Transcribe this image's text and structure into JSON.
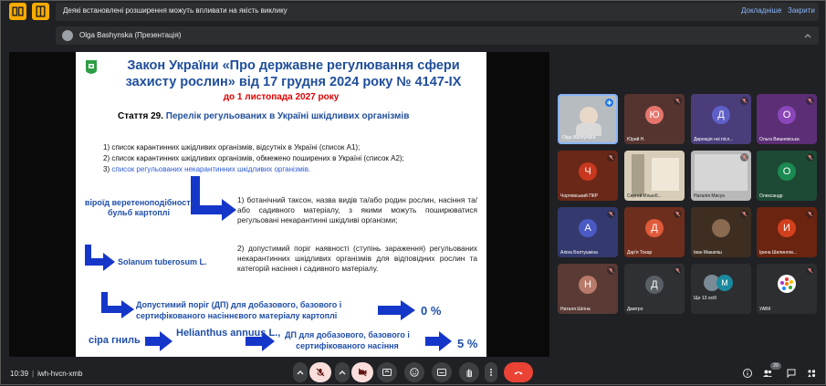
{
  "banner": {
    "message": "Деякі встановлені розширення можуть впливати на якість виклику",
    "details": "Докладніше",
    "close": "Закрити"
  },
  "presenter": {
    "label": "Olga Bashynska (Презентація)"
  },
  "slide": {
    "title": "Закон України «Про державне регулювання сфери захисту рослин» від 17 грудня 2024 року № 4147-ІХ",
    "date": "до 1 листопада 2027 року",
    "article_num": "Стаття 29.",
    "article_title": "Перелік регульованих в Україні шкідливих організмів",
    "list": [
      "1) список карантинних шкідливих організмів, відсутніх в Україні (список А1);",
      "2) список карантинних шкідливих організмів, обмежено поширених в Україні (список А2);",
      "3)",
      "список регульованих некарантинних шкідливих організмів."
    ],
    "viroid": "віроїд веретеноподібності бульб картоплі",
    "solanum": "Solanum tuberosum L.",
    "para1": "1) ботанічний таксон, назва видів та/або родин рослин, насіння та/або садивного матеріалу, з якими можуть поширюватися регульовані некарантинні шкідливі організми;",
    "para2": "2) допустимий поріг наявності (ступінь зараження) регульованих некарантинних шкідливих організмів для відповідних рослин та категорій насіння і садивного матеріалу.",
    "dp1": "Допустимий поріг (ДП) для добазового, базового і сертифікованого насіннєвого матеріалу картоплі",
    "pct0": "0 %",
    "gnyl": "сіра гниль",
    "helianthus": "Helianthus annuus L.,",
    "dp2": "ДП для добазового, базового і сертифікованого насіння",
    "pct5": "5 %"
  },
  "participants": [
    {
      "name": "Olga Bashynska",
      "initial": "",
      "color": "#b7bcc1"
    },
    {
      "name": "Юрий Н.",
      "initial": "Ю",
      "color": "#e5756c"
    },
    {
      "name": "Дирекція нні післ...",
      "initial": "Д",
      "color": "#5e60c8"
    },
    {
      "name": "Ольга Вишневська",
      "initial": "О",
      "color": "#8a46b8"
    },
    {
      "name": "Чортківський ПКР",
      "initial": "Ч",
      "color": "#c9381e"
    },
    {
      "name": "Сергей Ильюб...",
      "initial": "",
      "color": "#c8b89a"
    },
    {
      "name": "Наталія Мисун",
      "initial": "",
      "color": "#c9c9c9"
    },
    {
      "name": "Олександр",
      "initial": "О",
      "color": "#1a8a52"
    },
    {
      "name": "Аліна Болтушкіна",
      "initial": "А",
      "color": "#4a5ac4"
    },
    {
      "name": "Дар'я Токар",
      "initial": "Д",
      "color": "#e05a3a"
    },
    {
      "name": "Іван Макапіш",
      "initial": "",
      "color": "#8a6a50"
    },
    {
      "name": "Ірина Шилингов...",
      "initial": "И",
      "color": "#d2401e"
    },
    {
      "name": "Наталя Шеїна",
      "initial": "Н",
      "color": "#b87a6a"
    },
    {
      "name": "Дмитро",
      "initial": "Д",
      "color": "#5a5f66"
    },
    {
      "name": "Ще 13 осіб",
      "initial": "",
      "color": "#3c4043"
    },
    {
      "name": "УАВК",
      "initial": "",
      "color": "#ffffff"
    }
  ],
  "bottom": {
    "time": "10:39",
    "meeting_code": "iwh-hvcn-xmb",
    "participant_count": "29"
  },
  "icons": {
    "mic": "mic-off-icon",
    "camera": "camera-off-icon",
    "present": "present-screen-icon",
    "emoji": "emoji-icon",
    "captions": "captions-icon",
    "raise_hand": "raise-hand-icon",
    "more": "more-vert-icon",
    "end_call": "end-call-icon"
  }
}
